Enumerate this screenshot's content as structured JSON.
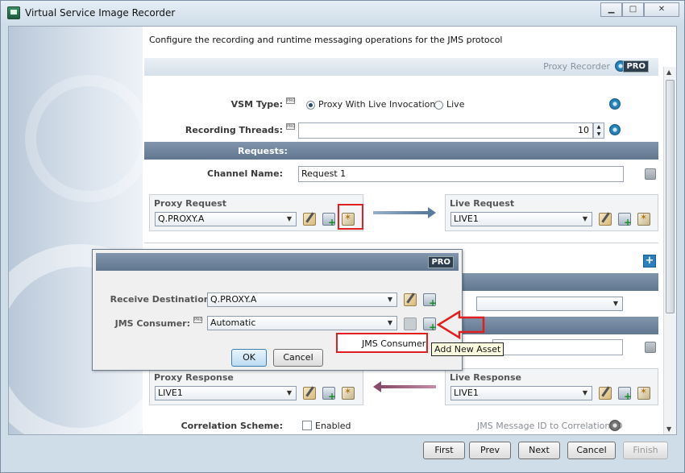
{
  "window": {
    "title": "Virtual Service Image Recorder"
  },
  "description": "Configure the recording and runtime messaging operations for the JMS protocol",
  "proxy_bar": {
    "label": "Proxy Recorder",
    "badge": "PRO"
  },
  "vsm_type": {
    "label": "VSM Type:",
    "option1": "Proxy With Live Invocation",
    "option2": "Live",
    "selected": "Proxy With Live Invocation"
  },
  "recording_threads": {
    "label": "Recording Threads:",
    "value": "10"
  },
  "requests": {
    "header": "Requests:",
    "channel_name_label": "Channel Name:",
    "channel_name_value": "Request 1",
    "proxy_request_title": "Proxy Request",
    "proxy_request_value": "Q.PROXY.A",
    "live_request_title": "Live Request",
    "live_request_value": "LIVE1"
  },
  "responses": {
    "proxy_response_title": "Proxy Response",
    "proxy_response_value": "LIVE1",
    "live_response_title": "Live Response",
    "live_response_value": "LIVE1",
    "correlation_label": "Correlation Scheme:",
    "correlation_checkbox": "Enabled",
    "correlation_type": "JMS Message ID to Correlation ID"
  },
  "dialog": {
    "badge": "PRO",
    "receive_destination_label": "Receive Destination:",
    "receive_destination_value": "Q.PROXY.A",
    "jms_consumer_label": "JMS Consumer:",
    "jms_consumer_value": "Automatic",
    "ok": "OK",
    "cancel": "Cancel"
  },
  "popup": {
    "item": "JMS Consumer"
  },
  "tooltip": "Add New Asset",
  "nav": {
    "first": "First",
    "prev": "Prev",
    "next": "Next",
    "cancel": "Cancel",
    "finish": "Finish"
  },
  "colors": {
    "accent_red": "#e02020",
    "header_blue": "#6e849c"
  }
}
